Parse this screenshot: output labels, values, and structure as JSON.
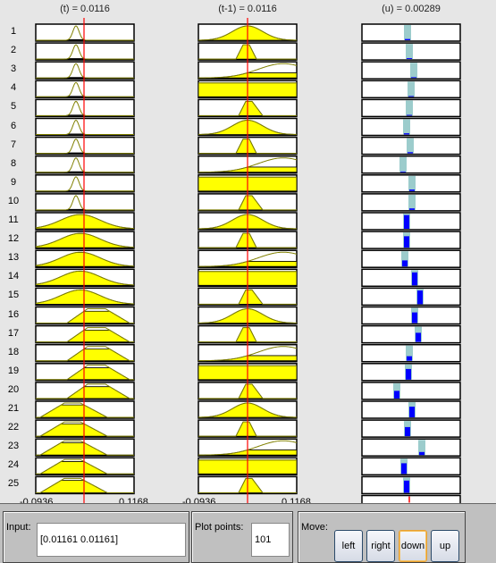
{
  "titles": {
    "input1": "(t) = 0.0116",
    "input2": "(t-1) = 0.0116",
    "output": "(u) = 0.00289"
  },
  "rule_numbers": [
    "1",
    "2",
    "3",
    "4",
    "5",
    "6",
    "7",
    "8",
    "9",
    "10",
    "11",
    "12",
    "13",
    "14",
    "15",
    "16",
    "17",
    "18",
    "19",
    "20",
    "21",
    "22",
    "23",
    "24",
    "25"
  ],
  "input_range": {
    "min": "-0.0936",
    "max": "0.1168"
  },
  "input_values": [
    0.0116,
    0.0116
  ],
  "colors": {
    "mf_fill": "#ffff00",
    "mf_line": "#808000",
    "indicator": "#ff0000",
    "output_bar": "#9ccccc",
    "firing": "#0000ff"
  },
  "bottom": {
    "input_label": "Input:",
    "input_value": "[0.01161 0.01161]",
    "plot_points_label": "Plot points:",
    "plot_points_value": "101",
    "move_label": "Move:",
    "buttons": {
      "left": "left",
      "right": "right",
      "down": "down",
      "up": "up"
    }
  }
}
